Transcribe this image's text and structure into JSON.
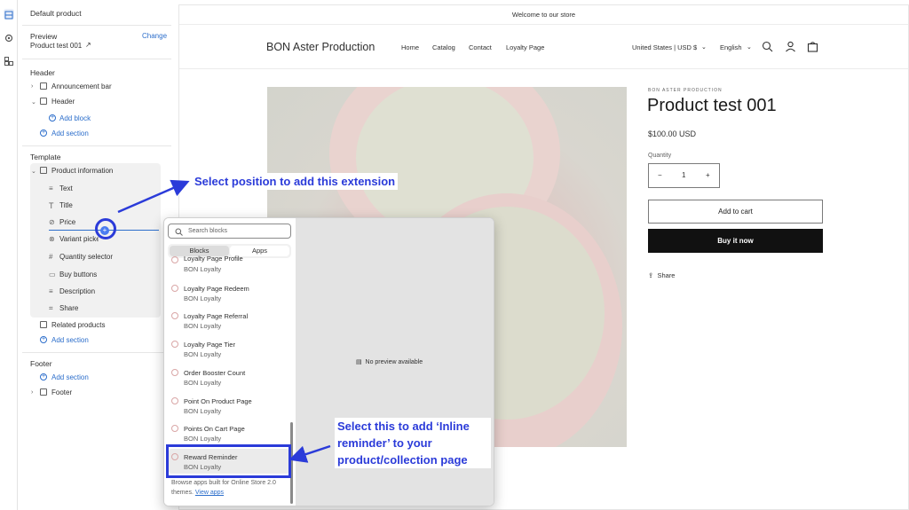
{
  "sidebar": {
    "top_title": "Default product",
    "preview_label": "Preview",
    "preview_value": "Product test 001",
    "change_link": "Change",
    "header_section": "Header",
    "announcement_bar": "Announcement bar",
    "header_item": "Header",
    "add_block": "Add block",
    "add_section": "Add section",
    "template_section": "Template",
    "product_information": "Product information",
    "blocks": [
      "Text",
      "Title",
      "Price",
      "Variant picker",
      "Quantity selector",
      "Buy buttons",
      "Description",
      "Share"
    ],
    "related_products": "Related products",
    "add_section_2": "Add section",
    "footer_section": "Footer",
    "add_section_3": "Add section",
    "footer_item": "Footer"
  },
  "store": {
    "announcement": "Welcome to our store",
    "title": "BON Aster Production",
    "nav": [
      "Home",
      "Catalog",
      "Contact",
      "Loyalty Page"
    ],
    "currency": "United States | USD $",
    "language": "English",
    "brand_small": "BON ASTER PRODUCTION",
    "product_title": "Product test 001",
    "price": "$100.00 USD",
    "quantity_label": "Quantity",
    "quantity_value": "1",
    "qty_minus": "−",
    "qty_plus": "+",
    "add_to_cart": "Add to cart",
    "buy_now": "Buy it now",
    "share": "Share"
  },
  "popup": {
    "search_placeholder": "Search blocks",
    "tab_blocks": "Blocks",
    "tab_apps": "Apps",
    "apps": [
      {
        "name": "Loyalty Page Profile",
        "vendor": "BON Loyalty"
      },
      {
        "name": "Loyalty Page Redeem",
        "vendor": "BON Loyalty"
      },
      {
        "name": "Loyalty Page Referral",
        "vendor": "BON Loyalty"
      },
      {
        "name": "Loyalty Page Tier",
        "vendor": "BON Loyalty"
      },
      {
        "name": "Order Booster Count",
        "vendor": "BON Loyalty"
      },
      {
        "name": "Point On Product Page",
        "vendor": "BON Loyalty"
      },
      {
        "name": "Points On Cart Page",
        "vendor": "BON Loyalty"
      },
      {
        "name": "Reward Reminder",
        "vendor": "BON Loyalty"
      }
    ],
    "browse_text": "Browse apps built for Online Store 2.0 themes.",
    "view_apps": "View apps",
    "no_preview": "No preview available"
  },
  "annotations": {
    "select_position": "Select position to add this extension",
    "select_this_1": "Select this to add ‘Inline",
    "select_this_2": "reminder’ to your",
    "select_this_3": "product/collection page"
  },
  "colors": {
    "annotation": "#2b3bd9",
    "link": "#2c6ecb",
    "buy_button": "#111111"
  }
}
